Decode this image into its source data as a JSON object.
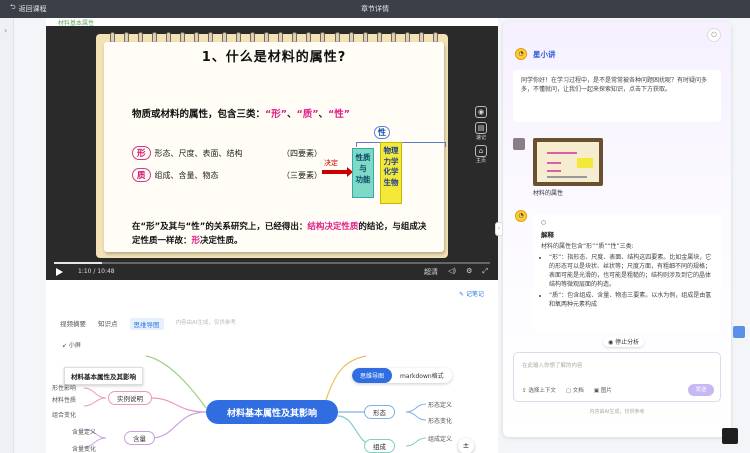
{
  "topbar": {
    "back_label": "返回课程",
    "title": "章节详情"
  },
  "crumb": "材料基本属性",
  "slide": {
    "title": "1、什么是材料的属性?",
    "intro_prefix": "物质或材料的属性，包含三类：",
    "intro_q1": "“形”",
    "intro_sep1": "、",
    "intro_q2": "“质”",
    "intro_sep2": "、",
    "intro_q3": "“性”",
    "row1_tag": "形",
    "row1_text": "形态、尺度、表面、结构",
    "row1_elem": "（四要素）",
    "row2_tag": "质",
    "row2_text": "组成、含量、物态",
    "row2_elem": "（三要素）",
    "decide": "决定",
    "xing": "性",
    "teal_lines": [
      "性质",
      "与",
      "功能"
    ],
    "yellow_lines": [
      "物理",
      "力学",
      "化学",
      "生物"
    ],
    "concl_a": "在“形”及其与“性”的关系研究上，已经得出：",
    "concl_b": "结构决定性质",
    "concl_c": "的结论，与组成决定性质一样故：",
    "concl_d": "形",
    "concl_e": "决定性质。"
  },
  "side_icons": [
    {
      "name": "screenshot-icon",
      "glyph": "◉",
      "label": ""
    },
    {
      "name": "notes-icon",
      "glyph": "▤",
      "label": "速记"
    },
    {
      "name": "home-icon",
      "glyph": "⌂",
      "label": "主页"
    }
  ],
  "player": {
    "time": "1:10 / 10:48",
    "progress_fraction": 0.11,
    "clarity": "超清",
    "volume_glyph": "◁)",
    "settings_glyph": "⚙",
    "fullscreen_glyph": "⤢"
  },
  "notes_label": "记笔记",
  "tabs": [
    {
      "label": "视频摘要",
      "active": false
    },
    {
      "label": "知识点",
      "active": false
    },
    {
      "label": "思维导图",
      "active": true
    }
  ],
  "tabs_hint": "内容由AI生成，仅供参考",
  "collapse_label": "↙ 小屏",
  "mindmap": {
    "tooltip": "材料基本属性及其影响",
    "center": "材料基本属性及其影响",
    "toggle_on": "思维导图",
    "toggle_off": "markdown格式",
    "left_nodes": [
      "实例说明",
      "含量"
    ],
    "right_nodes": [
      "形态",
      "组成"
    ],
    "leaf_left": [
      "形性影响",
      "材料性质",
      "组合变化",
      "含量定义",
      "含量变化"
    ],
    "leaf_right": [
      "形态定义",
      "形态变化",
      "组成定义"
    ],
    "zoom": "±"
  },
  "panel": {
    "bot_name": "星小讲",
    "power_glyph": "⏻",
    "greeting": "同学你好！在学习过程中，是不是常常被各种问题困扰呢？有时疑问多多，不懂就问，让我们一起来探索知识，点击下方获取。",
    "thumb_caption": "材料的属性",
    "reply_title": "解释",
    "reply_intro": "材料的属性包含“形”“质”“性”三类:",
    "reply_items": [
      "“形”：指形态、尺度、表面、结构这四要素。比如金属块，它的形态可以是块状、丝状等；尺度方面，有粗细不同的规格；表面可能是光滑的，也可能是粗糙的；结构则涉及到它的晶体结构等微观层面的构造。",
      "“质”：包含组成、含量、物态三要素。以水为例，组成是由氢和氧两种元素构成"
    ],
    "stop_label": "停止分析",
    "input_placeholder": "在此输入你想了解的内容",
    "ops": [
      "⇪ 选择上下文",
      "▢ 文档",
      "▣ 图片"
    ],
    "send_label": "发送",
    "disclaimer": "内容由AI生成，仅供参考"
  },
  "colors": {
    "accent": "#2f6de1",
    "magenta": "#e01f86",
    "panel_accent": "#2d58d6"
  }
}
